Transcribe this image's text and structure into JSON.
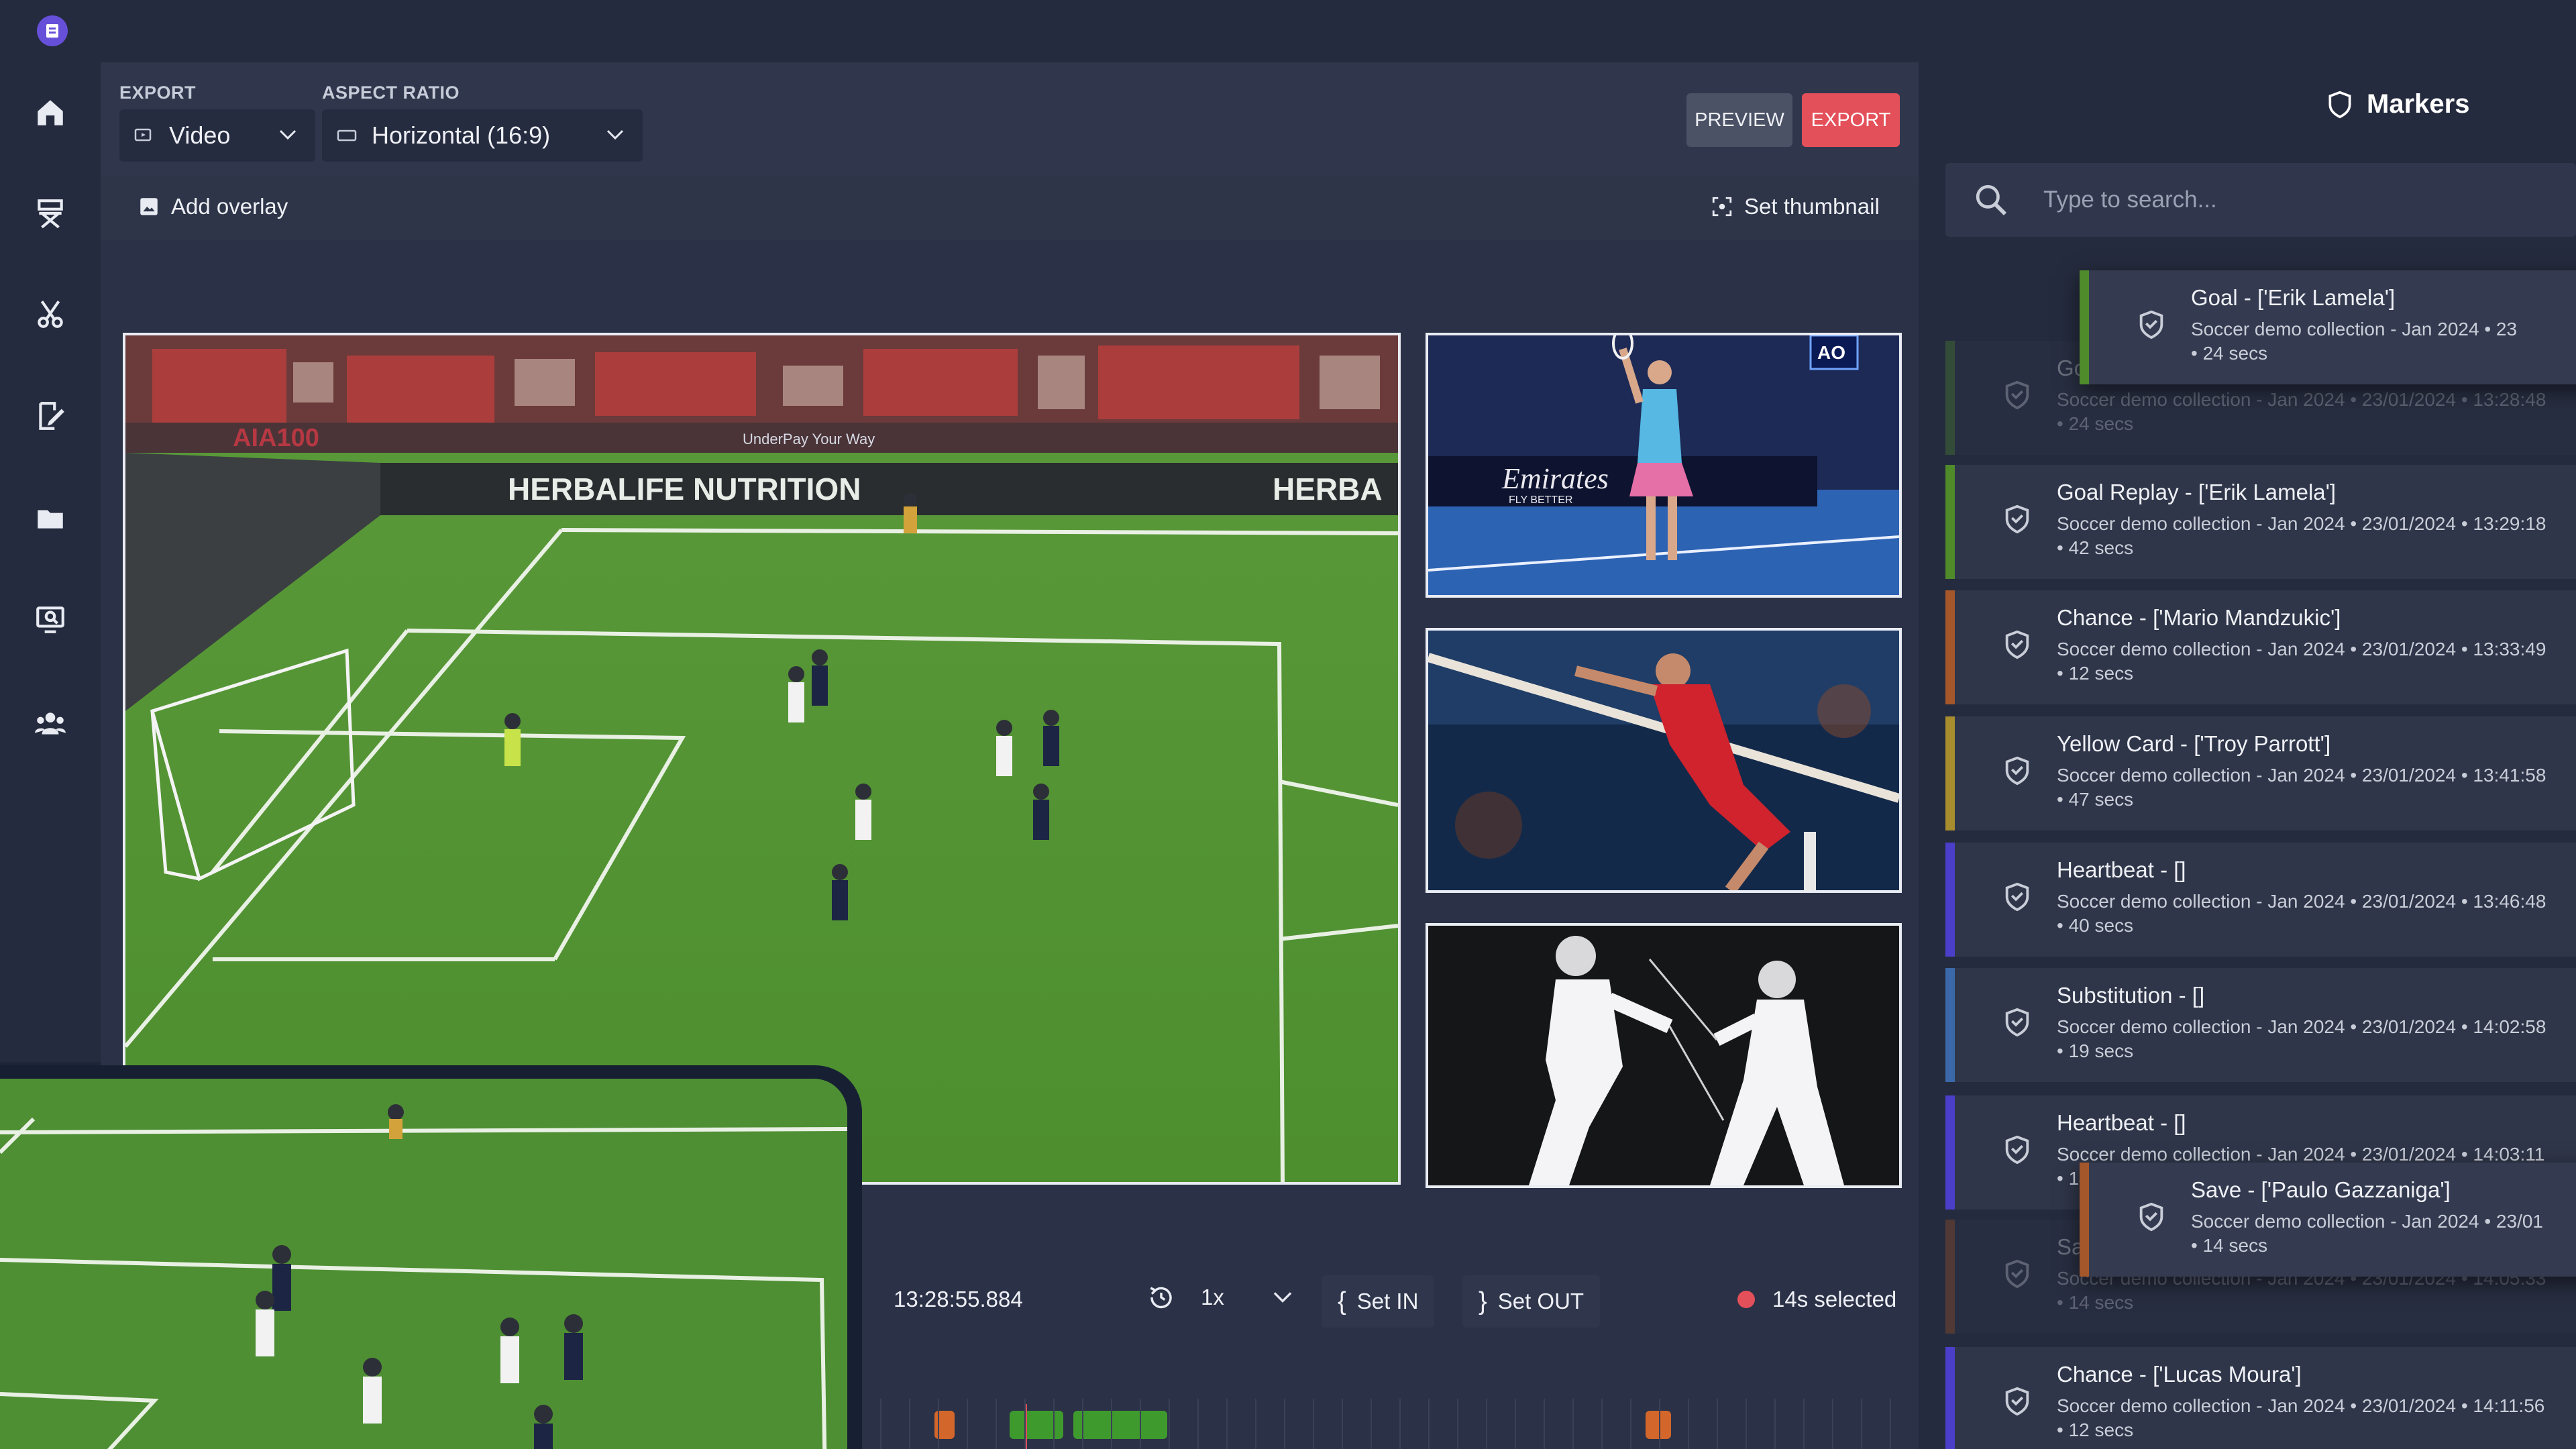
{
  "toolbar": {
    "export_label": "EXPORT",
    "export_value": "Video",
    "aspect_label": "ASPECT RATIO",
    "aspect_value": "Horizontal (16:9)",
    "preview_button": "PREVIEW",
    "export_button": "EXPORT"
  },
  "subbar": {
    "add_overlay": "Add overlay",
    "set_thumbnail": "Set thumbnail"
  },
  "video": {
    "banner_main": "HERBALIFE NUTRITION",
    "banner_right": "HERBA",
    "hoarding_left": "AIA100",
    "hoarding_mid": "UnderPay Your Way",
    "thumb_tennis_sponsor": "Emirates",
    "thumb_tennis_sponsor_sub": "FLY BETTER",
    "thumb_tennis_logo": "AO"
  },
  "timeline": {
    "timecode": "13:28:55.884",
    "speed": "1x",
    "set_in": "Set IN",
    "set_out": "Set OUT",
    "selected": "14s selected"
  },
  "markers": {
    "title": "Markers",
    "search_placeholder": "Type to search...",
    "items": [
      {
        "title": "Goal - ['Erik Lamela']",
        "meta": "Soccer demo collection - Jan 2024 • 23/01/2024 • 13:28:48",
        "duration": "• 24 secs",
        "color": "#4f8a2b"
      },
      {
        "title": "Goal Replay - ['Erik Lamela']",
        "meta": "Soccer demo collection - Jan 2024 • 23/01/2024 • 13:29:18",
        "duration": "• 42 secs",
        "color": "#4f8a2b"
      },
      {
        "title": "Chance - ['Mario Mandzukic']",
        "meta": "Soccer demo collection - Jan 2024 • 23/01/2024 • 13:33:49",
        "duration": "• 12 secs",
        "color": "#a4572a"
      },
      {
        "title": "Yellow Card - ['Troy Parrott']",
        "meta": "Soccer demo collection - Jan 2024 • 23/01/2024 • 13:41:58",
        "duration": "• 47 secs",
        "color": "#a88d2e"
      },
      {
        "title": "Heartbeat - []",
        "meta": "Soccer demo collection - Jan 2024 • 23/01/2024 • 13:46:48",
        "duration": "• 40 secs",
        "color": "#4b3fc9"
      },
      {
        "title": "Substitution - []",
        "meta": "Soccer demo collection - Jan 2024 • 23/01/2024 • 14:02:58",
        "duration": "• 19 secs",
        "color": "#3a68a8"
      },
      {
        "title": "Heartbeat - []",
        "meta": "Soccer demo collection - Jan 2024 • 23/01/2024 • 14:03:11",
        "duration": "• 14 secs",
        "color": "#4b3fc9"
      },
      {
        "title": "Save - ['Paulo Gazzaniga']",
        "meta": "Soccer demo collection - Jan 2024 • 23/01/2024 • 14:05:33",
        "duration": "• 14 secs",
        "color": "#a4572a"
      },
      {
        "title": "Chance - ['Lucas Moura']",
        "meta": "Soccer demo collection - Jan 2024 • 23/01/2024 • 14:11:56",
        "duration": "• 12 secs",
        "color": "#4b3fc9"
      }
    ],
    "floating_top": {
      "title": "Goal - ['Erik Lamela']",
      "meta": "Soccer demo collection - Jan 2024 • 23",
      "duration": "• 24 secs",
      "color": "#4f8a2b"
    },
    "floating_bottom": {
      "title": "Save - ['Paulo Gazzaniga']",
      "meta": "Soccer demo collection - Jan 2024 • 23/01",
      "duration": "• 14 secs",
      "color": "#a4572a"
    }
  },
  "colors": {
    "accent": "#6750d9",
    "export": "#e4505a",
    "record_dot": "#e4505a",
    "chip_orange": "#d3662a",
    "chip_green": "#3f9a2e"
  }
}
